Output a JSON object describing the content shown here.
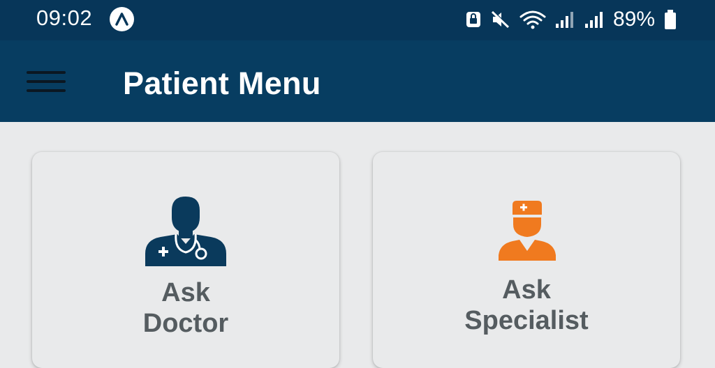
{
  "status_bar": {
    "time": "09:02",
    "battery": "89%",
    "icons": [
      "app-notification-icon",
      "lock-screen-icon",
      "mute-icon",
      "wifi-icon",
      "signal-icon",
      "signal-icon",
      "battery-icon"
    ]
  },
  "app_bar": {
    "title": "Patient Menu",
    "menu_icon": "hamburger-menu-icon",
    "background_color": "#073d61"
  },
  "cards": [
    {
      "label_line1": "Ask",
      "label_line2": "Doctor",
      "icon": "doctor-stethoscope-icon",
      "icon_color": "#0a3a5c"
    },
    {
      "label_line1": "Ask",
      "label_line2": "Specialist",
      "icon": "nurse-icon",
      "icon_color": "#f07a1f"
    }
  ]
}
